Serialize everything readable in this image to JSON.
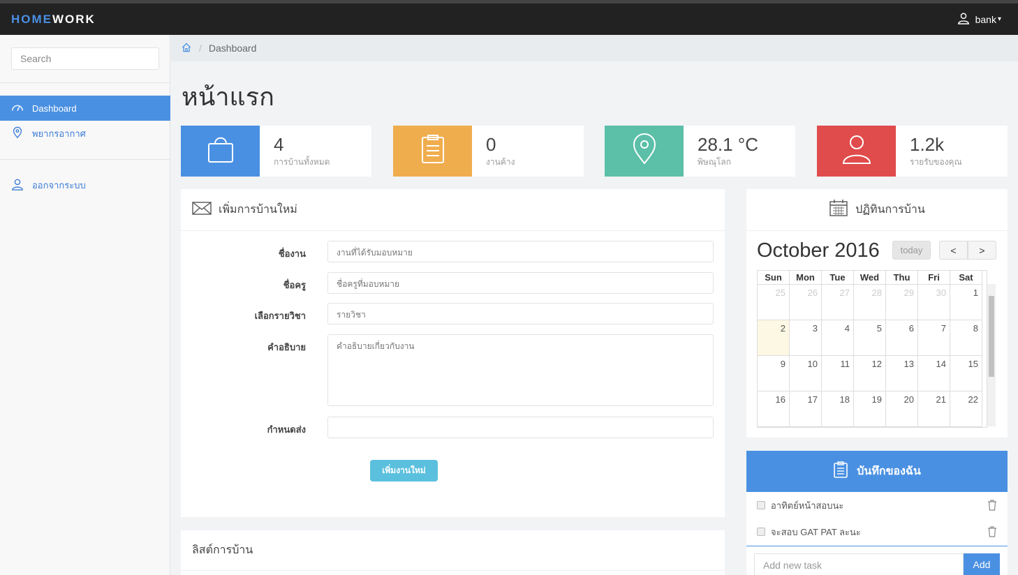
{
  "brand": {
    "part1": "HOME",
    "part2": "WORK"
  },
  "user": {
    "name": "bank",
    "caret": "▾"
  },
  "sidebar": {
    "search_placeholder": "Search",
    "items": [
      {
        "label": "Dashboard",
        "icon": "dashboard-icon",
        "active": true
      },
      {
        "label": "พยากรอากาศ",
        "icon": "map-pin-icon"
      },
      {
        "label": "ออกจากระบบ",
        "icon": "user-icon"
      }
    ]
  },
  "breadcrumb": {
    "current": "Dashboard"
  },
  "page": {
    "title": "หน้าแรก"
  },
  "stats": [
    {
      "value": "4",
      "label": "การบ้านทั้งหมด",
      "color": "#4a90e2",
      "icon": "shopping-bag-icon"
    },
    {
      "value": "0",
      "label": "งานค้าง",
      "color": "#f0ad4e",
      "icon": "clipboard-icon"
    },
    {
      "value": "28.1 °C",
      "label": "พิษณุโลก",
      "color": "#5cbfa8",
      "icon": "map-pin-icon"
    },
    {
      "value": "1.2k",
      "label": "รายรับของคุณ",
      "color": "#e04b4b",
      "icon": "user-icon"
    }
  ],
  "form": {
    "title": "เพิ่มการบ้านใหม่",
    "fields": [
      {
        "label": "ชื่องาน",
        "placeholder": "งานที่ได้รับมอบหมาย"
      },
      {
        "label": "ชื่อครู",
        "placeholder": "ชื่อครูที่มอบหมาย"
      },
      {
        "label": "เลือกรายวิชา",
        "placeholder": "รายวิชา"
      },
      {
        "label": "คำอธิบาย",
        "placeholder": "คำอธิบายเกี่ยวกับงาน"
      },
      {
        "label": "กำหนดส่ง",
        "placeholder": ""
      }
    ],
    "submit_label": "เพิ่มงานใหม่"
  },
  "list_panel": {
    "title": "ลิสต์การบ้าน"
  },
  "calendar": {
    "header": "ปฏิทินการบ้าน",
    "title": "October 2016",
    "today_label": "today",
    "prev_label": "<",
    "next_label": ">",
    "days": [
      "Sun",
      "Mon",
      "Tue",
      "Wed",
      "Thu",
      "Fri",
      "Sat"
    ],
    "weeks": [
      [
        "25",
        "26",
        "27",
        "28",
        "29",
        "30",
        "1"
      ],
      [
        "2",
        "3",
        "4",
        "5",
        "6",
        "7",
        "8"
      ],
      [
        "9",
        "10",
        "11",
        "12",
        "13",
        "14",
        "15"
      ],
      [
        "16",
        "17",
        "18",
        "19",
        "20",
        "21",
        "22"
      ]
    ]
  },
  "notes": {
    "title": "บันทึกของฉัน",
    "items": [
      {
        "text": "อาทิตย์หน้าสอบนะ"
      },
      {
        "text": "จะสอบ GAT PAT ละนะ"
      }
    ],
    "add_placeholder": "Add new task",
    "add_label": "Add"
  }
}
